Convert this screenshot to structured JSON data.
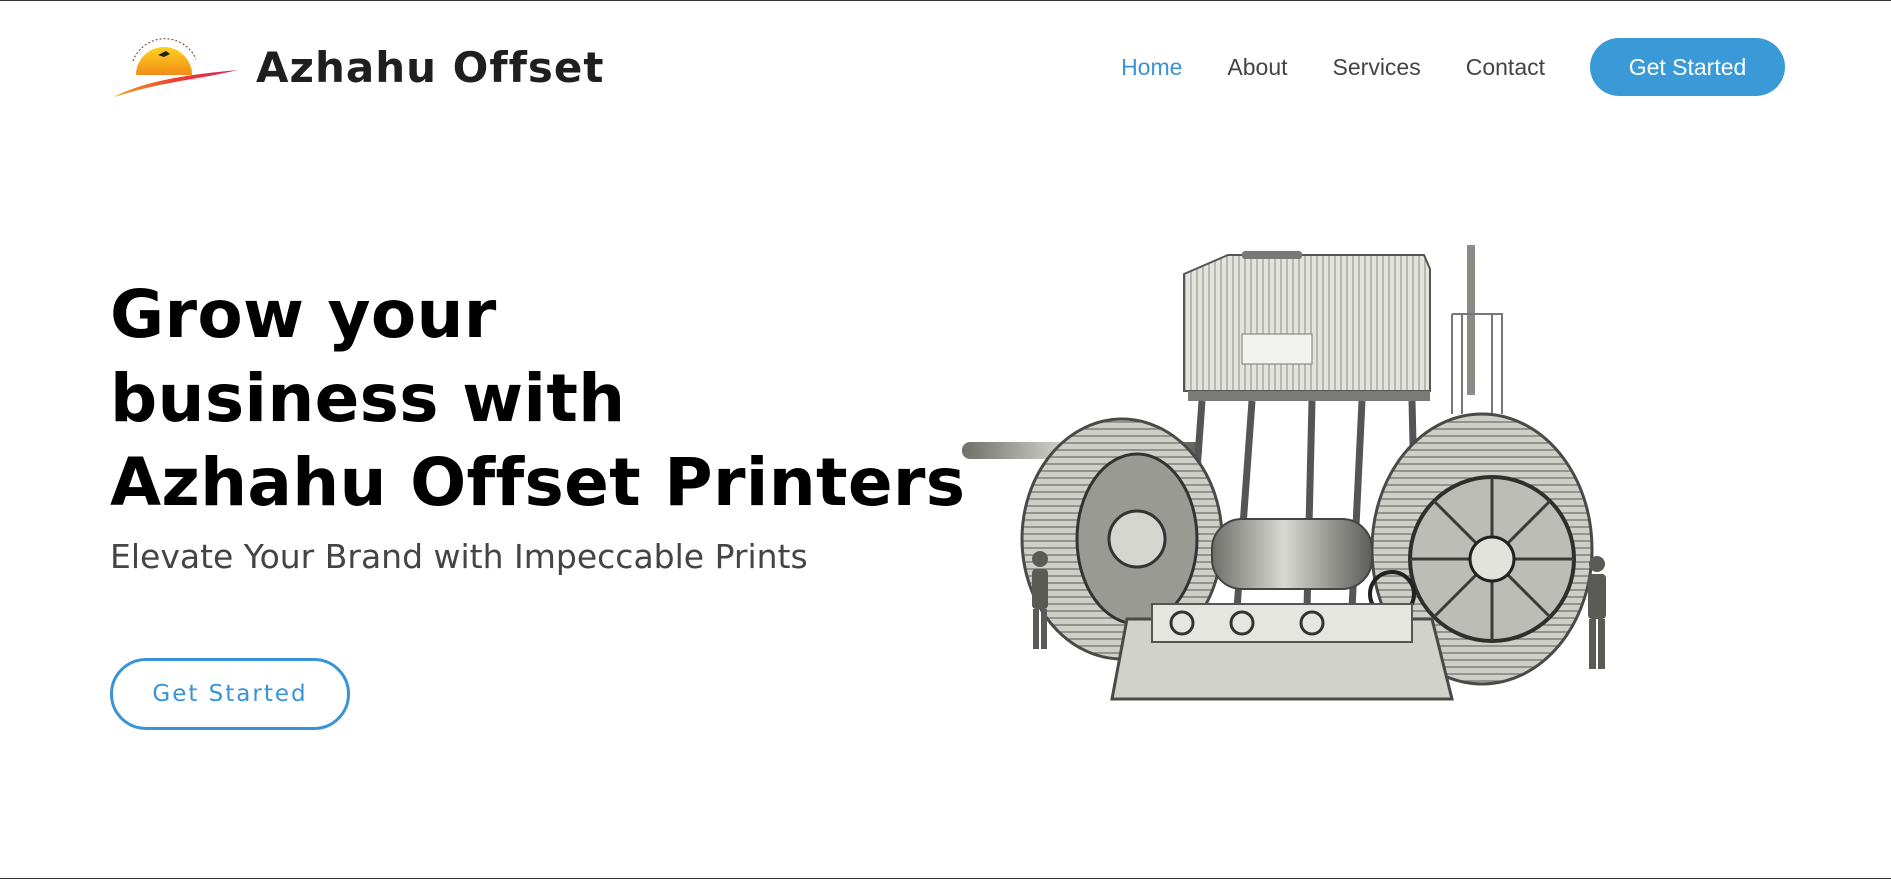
{
  "header": {
    "brand_name": "Azhahu Offset",
    "logo_icon": "sun-feather-logo",
    "nav": [
      {
        "label": "Home",
        "active": true
      },
      {
        "label": "About",
        "active": false
      },
      {
        "label": "Services",
        "active": false
      },
      {
        "label": "Contact",
        "active": false
      }
    ],
    "cta_label": "Get Started"
  },
  "hero": {
    "title_lines": [
      "Grow your",
      "business with",
      "Azhahu Offset Printers"
    ],
    "subtitle": "Elevate Your Brand with Impeccable Prints",
    "cta_label": "Get Started",
    "illustration": "vintage-printing-machine-engraving"
  },
  "colors": {
    "accent": "#3a9ad8",
    "active_link": "#3a93d6",
    "text_dark": "#000000",
    "text_muted": "#444444"
  }
}
